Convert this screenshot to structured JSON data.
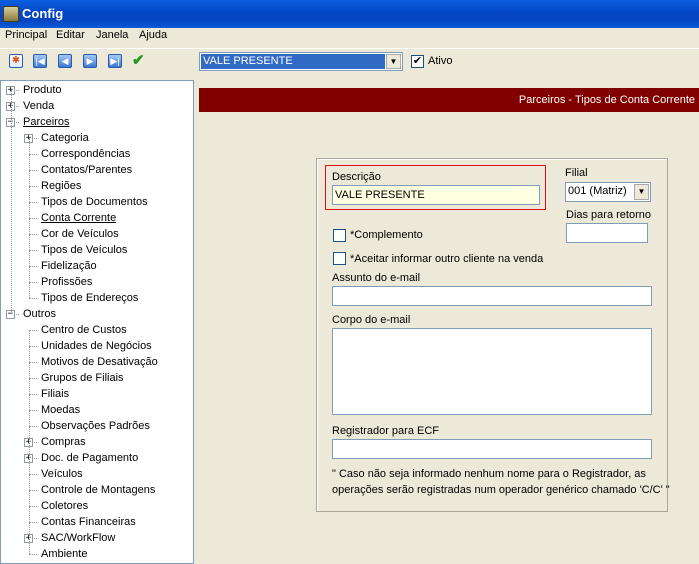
{
  "window": {
    "title": "Config"
  },
  "menu": [
    "Principal",
    "Editar",
    "Janela",
    "Ajuda"
  ],
  "toolbar": {
    "icons": [
      "new-icon",
      "first-icon",
      "previous-icon",
      "next-icon",
      "last-icon",
      "confirm-icon"
    ],
    "record_selector": "VALE PRESENTE",
    "ativo_label": "Ativo",
    "ativo_checked": true
  },
  "tree": [
    {
      "label": "Produto",
      "level": 0,
      "expander": "+"
    },
    {
      "label": "Venda",
      "level": 0,
      "expander": "+"
    },
    {
      "label": "Parceiros",
      "level": 0,
      "expander": "−"
    },
    {
      "label": "Categoria",
      "level": 1,
      "expander": "+"
    },
    {
      "label": "Correspondências",
      "level": 1
    },
    {
      "label": "Contatos/Parentes",
      "level": 1
    },
    {
      "label": "Regiões",
      "level": 1
    },
    {
      "label": "Tipos de Documentos",
      "level": 1
    },
    {
      "label": "Conta Corrente",
      "level": 1
    },
    {
      "label": "Cor de Veículos",
      "level": 1
    },
    {
      "label": "Tipos de Veículos",
      "level": 1
    },
    {
      "label": "Fidelização",
      "level": 1
    },
    {
      "label": "Profissões",
      "level": 1
    },
    {
      "label": "Tipos de Endereços",
      "level": 1
    },
    {
      "label": "Outros",
      "level": 0,
      "expander": "−"
    },
    {
      "label": "Centro de Custos",
      "level": 1
    },
    {
      "label": "Unidades de Negócios",
      "level": 1
    },
    {
      "label": "Motivos de Desativação",
      "level": 1
    },
    {
      "label": "Grupos de Filiais",
      "level": 1
    },
    {
      "label": "Filiais",
      "level": 1
    },
    {
      "label": "Moedas",
      "level": 1
    },
    {
      "label": "Observações Padrões",
      "level": 1
    },
    {
      "label": "Compras",
      "level": 1,
      "expander": "+"
    },
    {
      "label": "Doc. de Pagamento",
      "level": 1,
      "expander": "+"
    },
    {
      "label": "Veículos",
      "level": 1
    },
    {
      "label": "Controle de Montagens",
      "level": 1
    },
    {
      "label": "Coletores",
      "level": 1
    },
    {
      "label": "Contas Financeiras",
      "level": 1
    },
    {
      "label": "SAC/WorkFlow",
      "level": 1,
      "expander": "+"
    },
    {
      "label": "Ambiente",
      "level": 1
    }
  ],
  "header": {
    "breadcrumb": "Parceiros - Tipos de Conta Corrente",
    "color": "#800000"
  },
  "form": {
    "descricao_label": "Descrição",
    "descricao_value": "VALE PRESENTE",
    "filial_label": "Filial",
    "filial_value": "001 (Matriz)",
    "dias_label": "Dias para retorno",
    "dias_value": "",
    "complemento_label": "*Complemento",
    "complemento_checked": false,
    "aceitar_label": "*Aceitar informar outro cliente na venda",
    "aceitar_checked": false,
    "assunto_label": "Assunto do e-mail",
    "assunto_value": "",
    "corpo_label": "Corpo do e-mail",
    "corpo_value": "",
    "registrador_label": "Registrador para ECF",
    "registrador_value": "",
    "note_line1": "\" Caso não seja informado nenhum nome para o Registrador, as",
    "note_line2": "operações serão registradas num operador genérico chamado 'C/C' \""
  }
}
